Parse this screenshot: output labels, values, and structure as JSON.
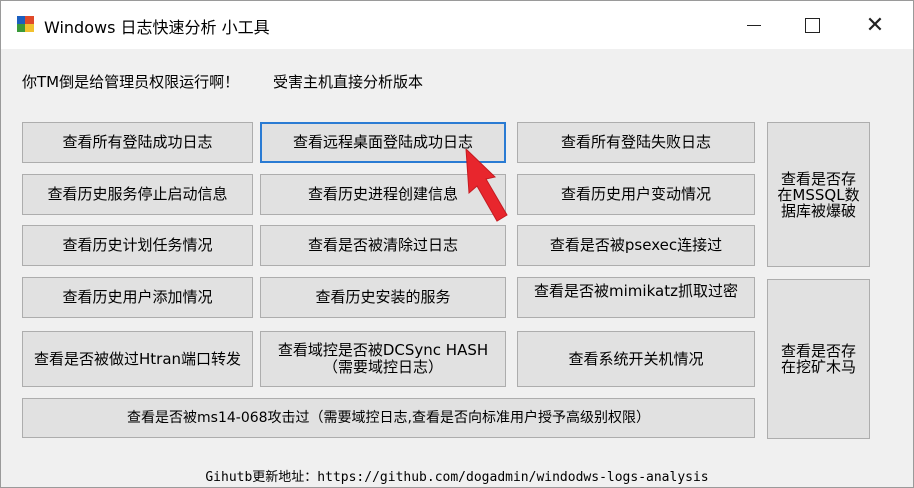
{
  "window": {
    "title": "Windows 日志快速分析 小工具",
    "controls": {
      "minimize": "—",
      "maximize": "☐",
      "close": "✕"
    }
  },
  "labels": {
    "warning": "你TM倒是给管理员权限运行啊！",
    "version": "受害主机直接分析版本"
  },
  "buttons": {
    "all_login_success": "查看所有登陆成功日志",
    "rdp_login_success": "查看远程桌面登陆成功日志",
    "all_login_failed": "查看所有登陆失败日志",
    "mssql_bruteforce": "查看是否存在MSSQL数据库被爆破",
    "service_history": "查看历史服务停止启动信息",
    "process_history": "查看历史进程创建信息",
    "user_change_history": "查看历史用户变动情况",
    "scheduled_tasks": "查看历史计划任务情况",
    "log_cleared": "查看是否被清除过日志",
    "psexec": "查看是否被psexec连接过",
    "user_added": "查看历史用户添加情况",
    "service_installed": "查看历史安装的服务",
    "mimikatz": "查看是否被mimikatz抓取过密",
    "htran": "查看是否被做过Htran端口转发",
    "dcsync": "查看域控是否被DCSync HASH（需要域控日志）",
    "shutdown_boot": "查看系统开关机情况",
    "mining": "查看是否存在挖矿木马",
    "ms14_068": "查看是否被ms14-068攻击过（需要域控日志,查看是否向标准用户授予高级别权限）"
  },
  "footer": "Gihutb更新地址：https://github.com/dogadmin/windodws-logs-analysis"
}
